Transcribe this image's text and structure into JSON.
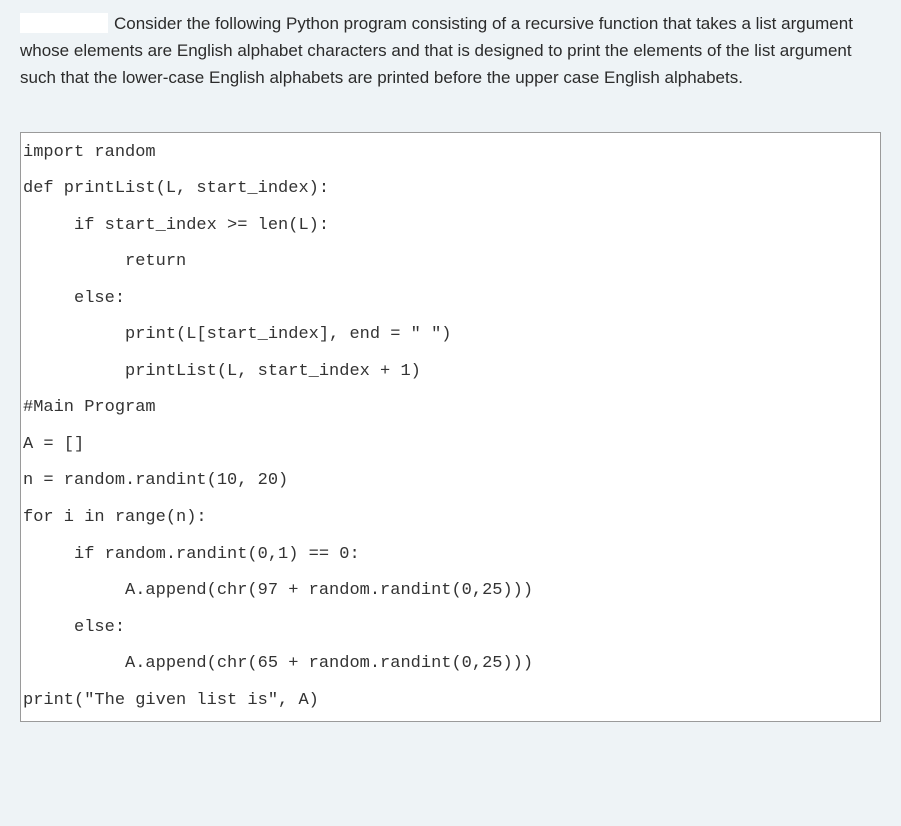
{
  "question": {
    "prompt_text": "Consider the following Python program consisting of a recursive function that takes a list argument whose elements are English alphabet characters and that is designed to print the elements of the list argument such that the lower-case English alphabets are printed before the upper case English alphabets."
  },
  "code": {
    "lines": [
      "import random",
      "def printList(L, start_index):",
      "     if start_index >= len(L):",
      "          return",
      "     else:",
      "          print(L[start_index], end = \" \")",
      "          printList(L, start_index + 1)",
      "",
      "#Main Program",
      "A = []",
      "n = random.randint(10, 20)",
      "for i in range(n):",
      "     if random.randint(0,1) == 0:",
      "          A.append(chr(97 + random.randint(0,25)))",
      "     else:",
      "          A.append(chr(65 + random.randint(0,25)))",
      "print(\"The given list is\", A)"
    ]
  }
}
